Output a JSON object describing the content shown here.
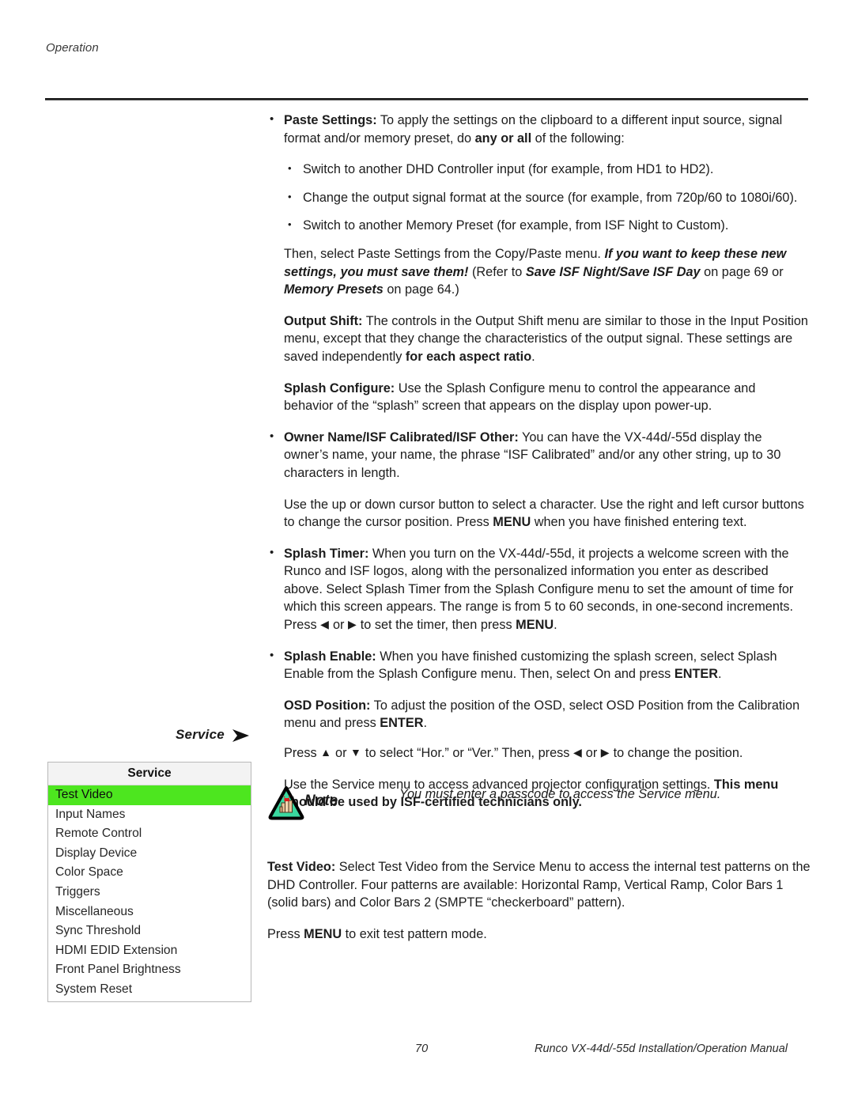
{
  "page": {
    "running_head": "Operation",
    "footer_page_number": "70",
    "footer_manual_title": "Runco VX-44d/-55d Installation/Operation Manual"
  },
  "colors": {
    "menu_highlight_green": "#4de61f",
    "note_icon_fill": "#3ad9a0",
    "note_icon_border": "#000000",
    "note_ribbon_red": "#e01b1b",
    "rule": "#1a1a1a"
  },
  "content": {
    "paste_settings": {
      "term": "Paste Settings:",
      "body": " To apply the settings on the clipboard to a different input source, signal format and/or memory preset, do ",
      "emph": "any or all",
      "body_end": " of the following:",
      "sub_bullets": [
        "Switch to another DHD Controller input (for example, from HD1 to HD2).",
        "Change the output signal format at the source (for example, from 720p/60 to 1080i/60).",
        "Switch to another Memory Preset (for example, from ISF Night to Custom)."
      ],
      "followup_lead": "Then, select Paste Settings from the Copy/Paste menu. ",
      "followup_emph1": "If you want to keep these new settings, you must save them!",
      "followup_mid": " (Refer to ",
      "followup_emph2": "Save ISF Night/Save ISF Day",
      "followup_mid2": " on page 69 or ",
      "followup_emph3": "Memory Presets",
      "followup_end": " on page 64.)"
    },
    "output_shift": {
      "term": "Output Shift:",
      "body": " The controls in the Output Shift menu are similar to those in the Input Position menu, except that they change the characteristics of the output signal. These settings are saved independently ",
      "emph": "for each aspect ratio",
      "body_end": "."
    },
    "splash_configure": {
      "term": "Splash Configure:",
      "body": " Use the Splash Configure menu to control the appearance and behavior of the “splash” screen that appears on the display upon power-up."
    },
    "owner_name": {
      "term": "Owner Name/ISF Calibrated/ISF Other:",
      "body": " You can have the VX-44d/-55d display the owner’s name, your name, the phrase “ISF Calibrated” and/or any other string, up to 30 characters in length."
    },
    "cursor_help": {
      "lead": "Use the up or down cursor button to select a character. Use the right and left cursor buttons to change the cursor position. Press ",
      "key": "MENU",
      "tail": " when you have finished entering text."
    },
    "splash_timer": {
      "term": "Splash Timer:",
      "body": " When you turn on the VX-44d/-55d, it projects a welcome screen with the Runco and ISF logos, along with the personalized information you enter as described above. Select Splash Timer from the Splash Configure menu to set the amount of time for which this screen appears. The range is from 5 to 60 seconds, in one-second increments. Press ",
      "arrow_left": "◀",
      "mid": " or ",
      "arrow_right": "▶",
      "tail": " to set the timer, then press ",
      "key": "MENU",
      "end": "."
    },
    "splash_enable": {
      "term": "Splash Enable:",
      "body": " When you have finished customizing the splash screen, select Splash Enable from the Splash Configure menu. Then, select On and press ",
      "key": "ENTER",
      "end": "."
    },
    "osd_position": {
      "term": "OSD Position:",
      "body": " To adjust the position of the OSD, select OSD Position from the Calibration menu and press ",
      "key": "ENTER",
      "end": "."
    },
    "osd_press": {
      "lead": "Press ",
      "arrow_up": "▲",
      "mid1": " or ",
      "arrow_down": "▼",
      "mid2": " to select “Hor.” or “Ver.” Then, press ",
      "arrow_left": "◀",
      "mid3": " or ",
      "arrow_right": "▶",
      "tail": " to change the position."
    },
    "service_intro": {
      "body": "Use the Service menu to access advanced projector configuration settings. ",
      "emph": "This menu should be used by ISF-certified technicians only."
    },
    "note": {
      "label": "Note",
      "text": "You must enter a passcode to access the Service menu."
    },
    "test_video": {
      "term": "Test Video:",
      "body": " Select Test Video from the Service Menu to access the internal test patterns on the DHD Controller. Four patterns are available: Horizontal Ramp, Vertical Ramp, Color Bars 1 (solid bars) and Color Bars 2 (SMPTE “checkerboard” pattern)."
    },
    "exit_pattern": {
      "lead": "Press ",
      "key": "MENU",
      "tail": " to exit test pattern mode."
    }
  },
  "service_margin": {
    "label": "Service",
    "arrow_icon": "arrow-right-icon"
  },
  "service_menu": {
    "title": "Service",
    "selected_index": 0,
    "items": [
      "Test Video",
      "Input Names",
      "Remote Control",
      "Display Device",
      "Color Space",
      "Triggers",
      "Miscellaneous",
      "Sync Threshold",
      "HDMI EDID Extension",
      "Front Panel Brightness",
      "System Reset"
    ]
  }
}
